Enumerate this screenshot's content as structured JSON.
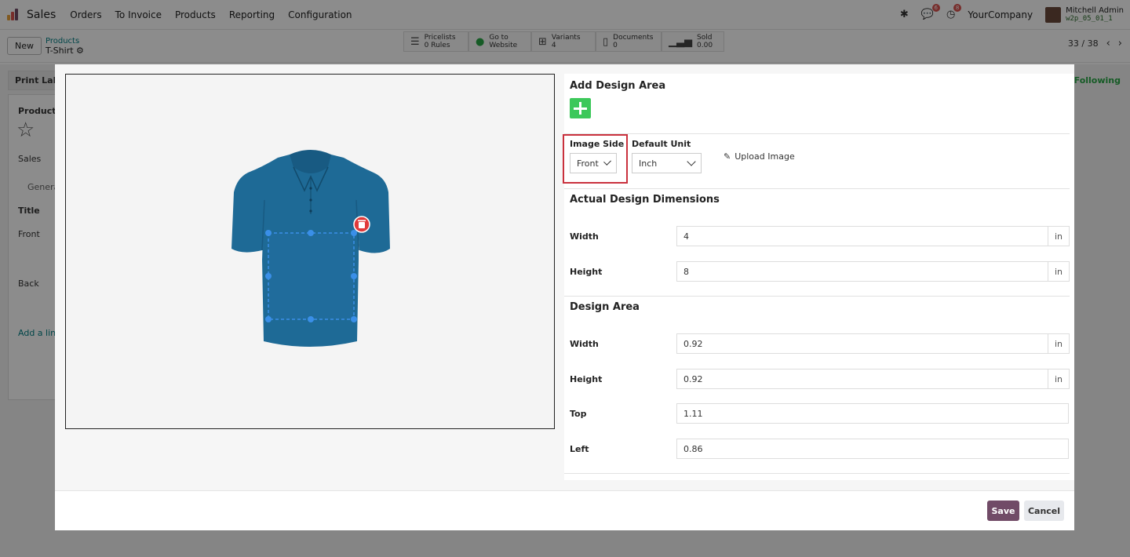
{
  "navbar": {
    "app_name": "Sales",
    "menu": [
      "Orders",
      "To Invoice",
      "Products",
      "Reporting",
      "Configuration"
    ],
    "activity_badge": "6",
    "clock_badge": "8",
    "company": "YourCompany",
    "user_name": "Mitchell Admin",
    "user_db": "w2p_05_01_1"
  },
  "control_panel": {
    "new_label": "New",
    "breadcrumb_parent": "Products",
    "breadcrumb_current": "T-Shirt",
    "stat_buttons": [
      {
        "line1": "Pricelists",
        "line2": "0  Rules",
        "icon": "list-icon"
      },
      {
        "line1": "Go to",
        "line2": "Website",
        "icon": "globe-icon"
      },
      {
        "line1": "Variants",
        "line2": "4",
        "icon": "sitemap-icon"
      },
      {
        "line1": "Documents",
        "line2": "0",
        "icon": "file-icon"
      },
      {
        "line1": "Sold",
        "line2": "0.00",
        "icon": "bar-chart-icon"
      }
    ],
    "pager": "33 / 38"
  },
  "background_form": {
    "print_labels": "Print Labe",
    "following": "Following",
    "product_label": "Product",
    "sales_label": "Sales",
    "tab_general": "Genera",
    "title_header": "Title",
    "row_front": "Front",
    "row_back": "Back",
    "add_line": "Add a line"
  },
  "dialog": {
    "add_design_area_title": "Add Design Area",
    "image_side_label": "Image Side",
    "image_side_value": "Front",
    "default_unit_label": "Default Unit",
    "default_unit_value": "Inch",
    "upload_image_label": "Upload Image",
    "actual_dimensions_title": "Actual Design Dimensions",
    "actual": {
      "width_label": "Width",
      "width_value": "4",
      "width_unit": "in",
      "height_label": "Height",
      "height_value": "8",
      "height_unit": "in"
    },
    "design_area_title": "Design Area",
    "area": {
      "width_label": "Width",
      "width_value": "0.92",
      "width_unit": "in",
      "height_label": "Height",
      "height_value": "0.92",
      "height_unit": "in",
      "top_label": "Top",
      "top_value": "1.11",
      "left_label": "Left",
      "left_value": "0.86"
    },
    "save_label": "Save",
    "cancel_label": "Cancel"
  },
  "colors": {
    "shirt": "#1e6a96",
    "selection": "#3a8fe8",
    "add_button": "#3cc85a",
    "save_button": "#714b67",
    "highlight": "#c9313d"
  }
}
